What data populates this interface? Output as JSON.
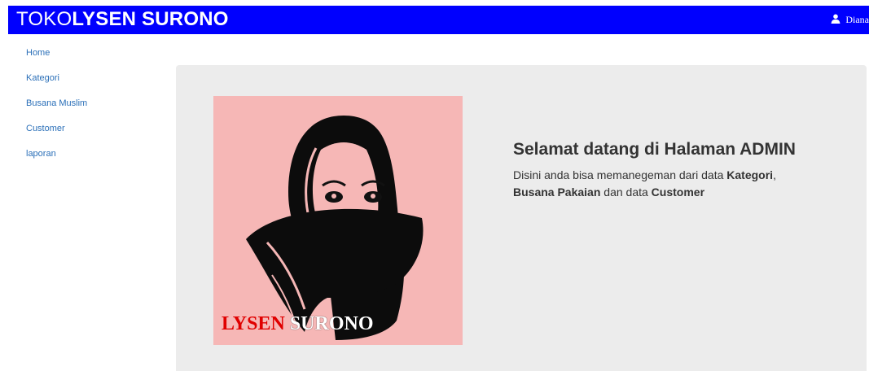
{
  "header": {
    "brand_part1": "TOKO",
    "brand_part2": "LYSEN SURONO",
    "user_name": "Diana",
    "bg_color": "#0000fe"
  },
  "sidebar": {
    "items": [
      {
        "label": "Home"
      },
      {
        "label": "Kategori"
      },
      {
        "label": "Busana Muslim"
      },
      {
        "label": "Customer"
      },
      {
        "label": "laporan"
      }
    ]
  },
  "main": {
    "image": {
      "logo_part1": "LYSEN",
      "logo_part2": "SURONO",
      "bg_color": "#f6b7b6"
    },
    "welcome": {
      "title": "Selamat datang di Halaman ADMIN",
      "text_1": "Disini anda bisa memanegeman dari data ",
      "bold_1": "Kategori",
      "text_2": ",",
      "bold_2": "Busana Pakaian",
      "text_3": " dan data ",
      "bold_3": "Customer"
    }
  },
  "icons": {
    "user": "user-icon"
  }
}
